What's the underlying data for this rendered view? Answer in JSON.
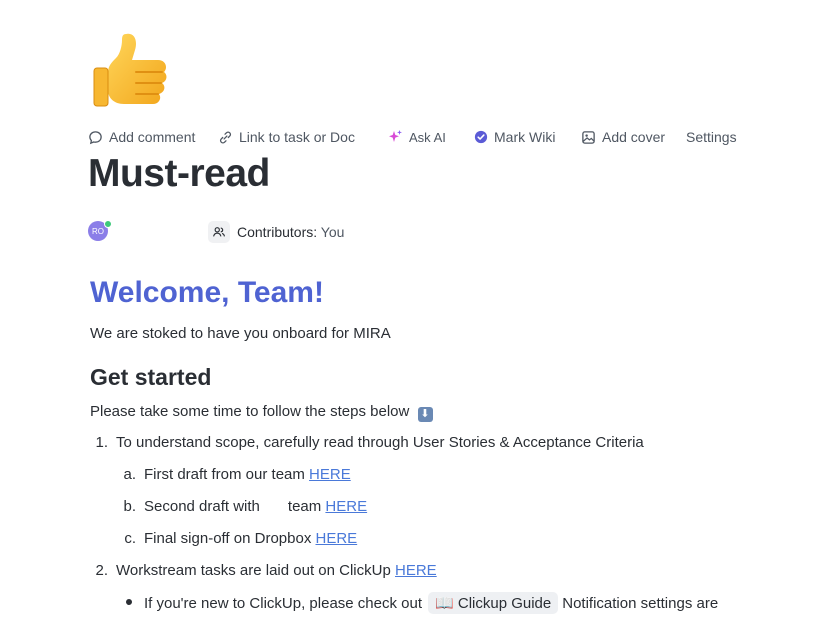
{
  "toolbar": {
    "add_comment": "Add comment",
    "link_task": "Link to task or Doc",
    "ask_ai": "Ask AI",
    "mark_wiki": "Mark Wiki",
    "add_cover": "Add cover",
    "settings": "Settings"
  },
  "doc": {
    "icon": "thumbs-up-emoji",
    "title": "Must-read",
    "avatar_initials": "RO",
    "contributors_label": "Contributors:",
    "contributors_value": "You"
  },
  "body": {
    "heading": "Welcome, Team!",
    "intro": "We are stoked to have you onboard for MIRA",
    "subheading": "Get started",
    "steps_intro": "Please take some time to follow the steps below",
    "steps_intro_emoji": "⬇",
    "step1": {
      "marker": "1.",
      "text": "To understand scope, carefully read through User Stories & Acceptance Criteria",
      "sub": [
        {
          "marker": "a.",
          "text": "First draft from our team ",
          "link": "HERE"
        },
        {
          "marker": "b.",
          "text_before": "Second draft with",
          "text_after": "team ",
          "link": "HERE"
        },
        {
          "marker": "c.",
          "text": "Final sign-off on Dropbox ",
          "link": "HERE"
        }
      ]
    },
    "step2": {
      "marker": "2.",
      "text": "Workstream tasks are laid out on ClickUp ",
      "link": "HERE",
      "bullet": {
        "text": "If you're new to ClickUp, please check out",
        "chip_emoji": "📖",
        "chip_label": "Clickup Guide",
        "text_after": "Notification settings are"
      }
    }
  },
  "colors": {
    "heading_blue": "#4f63d2",
    "link_blue": "#4a79d9",
    "text": "#2a2e34",
    "avatar": "#8b7ee8",
    "wiki_check": "#5b5bd6"
  }
}
